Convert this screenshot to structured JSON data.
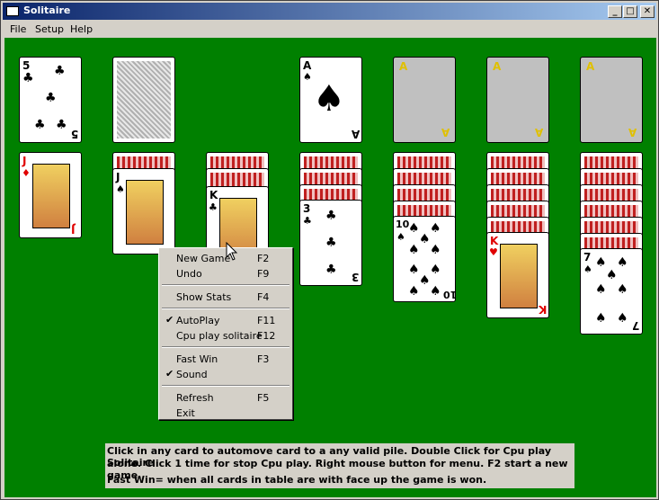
{
  "window": {
    "title": "Solitaire",
    "minimize": "_",
    "maximize": "□",
    "close": "✕"
  },
  "menu": [
    "File",
    "Setup",
    "Help"
  ],
  "colors": {
    "felt": "#008000",
    "titlebar_start": "#0a246a",
    "red_suit": "#e00000"
  },
  "top_row": {
    "stock": {
      "rank": "5",
      "suit": "♣",
      "suit_color": "black"
    },
    "waste": {
      "face": "down"
    },
    "foundation_1": {
      "rank": "A",
      "suit": "♠",
      "suit_color": "black"
    },
    "foundation_2": {
      "rank": "A",
      "placeholder": true
    },
    "foundation_3": {
      "rank": "A",
      "placeholder": true
    },
    "foundation_4": {
      "rank": "A",
      "placeholder": true
    }
  },
  "tableau": [
    {
      "hidden": 0,
      "top": {
        "rank": "J",
        "suit": "♦",
        "suit_color": "red"
      }
    },
    {
      "hidden": 1,
      "top": {
        "rank": "J",
        "suit": "♠",
        "suit_color": "black"
      }
    },
    {
      "hidden": 2,
      "top": {
        "rank": "K",
        "suit": "♣",
        "suit_color": "black"
      }
    },
    {
      "hidden": 3,
      "top": {
        "rank": "3",
        "suit": "♣",
        "suit_color": "black"
      }
    },
    {
      "hidden": 4,
      "top": {
        "rank": "10",
        "suit": "♠",
        "suit_color": "black"
      }
    },
    {
      "hidden": 5,
      "top": {
        "rank": "K",
        "suit": "♥",
        "suit_color": "red"
      }
    },
    {
      "hidden": 6,
      "top": {
        "rank": "7",
        "suit": "♠",
        "suit_color": "black"
      }
    }
  ],
  "context_menu": {
    "items": [
      {
        "label": "New Game",
        "shortcut": "F2",
        "checked": false
      },
      {
        "label": "Undo",
        "shortcut": "F9",
        "checked": false
      },
      {
        "label": "Show Stats",
        "shortcut": "F4",
        "checked": false
      },
      {
        "label": "AutoPlay",
        "shortcut": "F11",
        "checked": true
      },
      {
        "label": "Cpu play solitaire",
        "shortcut": "F12",
        "checked": false
      },
      {
        "label": "Fast Win",
        "shortcut": "F3",
        "checked": false
      },
      {
        "label": "Sound",
        "shortcut": "",
        "checked": true
      },
      {
        "label": "Refresh",
        "shortcut": "F5",
        "checked": false
      },
      {
        "label": "Exit",
        "shortcut": "",
        "checked": false
      }
    ],
    "check_glyph": "✔"
  },
  "info": {
    "line1": "Click in any card to automove card to a any valid pile. Double Click for Cpu play Solitaire",
    "line2": "alone. Click 1 time for stop Cpu play. Right mouse button for menu. F2 start a new game.",
    "line3": "Fast Win= when all cards in table are with face up the game is won."
  }
}
